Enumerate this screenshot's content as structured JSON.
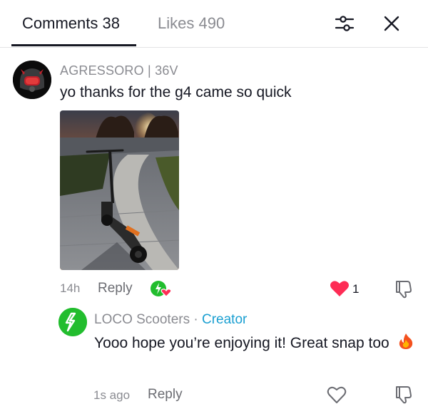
{
  "tabs": {
    "comments_label": "Comments 38",
    "likes_label": "Likes 490"
  },
  "comment": {
    "username": "AGRESSORO | 36V",
    "text": "yo thanks for the g4 came so quick",
    "time": "14h",
    "reply_label": "Reply",
    "like_count": "1",
    "liked": true,
    "liked_by_creator": true
  },
  "reply": {
    "username": "LOCO Scooters",
    "separator": "·",
    "badge": "Creator",
    "text": "Yooo hope you’re enjoying it! Great snap too",
    "emoji_icon": "fire-emoji-icon",
    "time": "1s ago",
    "reply_label": "Reply"
  },
  "colors": {
    "like_red": "#fe2c55",
    "creator_blue": "#1a9fd1",
    "brand_green": "#22bd2e",
    "muted_text": "#8a8b91"
  }
}
